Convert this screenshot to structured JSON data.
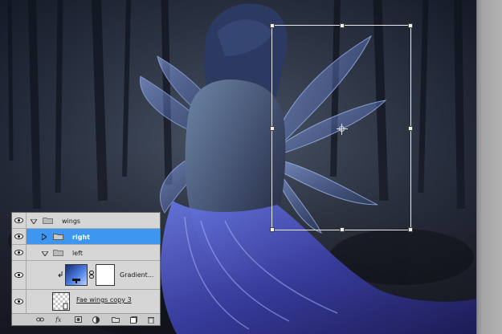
{
  "canvas": {
    "subject": "fairy-woman-with-wings-forest"
  },
  "layers_panel": {
    "layers": [
      {
        "name": "wings",
        "kind": "group",
        "expanded": true,
        "visible": true
      },
      {
        "name": "right",
        "kind": "group",
        "expanded": false,
        "visible": true,
        "selected": true
      },
      {
        "name": "left",
        "kind": "group",
        "expanded": true,
        "visible": true
      },
      {
        "name": "Gradient...",
        "kind": "adjustment",
        "visible": true
      },
      {
        "name": "Fae wings copy 3",
        "kind": "pixel",
        "visible": true
      }
    ],
    "toolbar_icons": [
      "link-layers-icon",
      "fx-icon",
      "add-mask-icon",
      "adjustment-icon",
      "new-group-icon",
      "new-layer-icon",
      "trash-icon"
    ]
  },
  "colors": {
    "selection": "#3d96f0",
    "panel_bg": "#d6d6d6",
    "transform_box": "#e8e8e8"
  }
}
